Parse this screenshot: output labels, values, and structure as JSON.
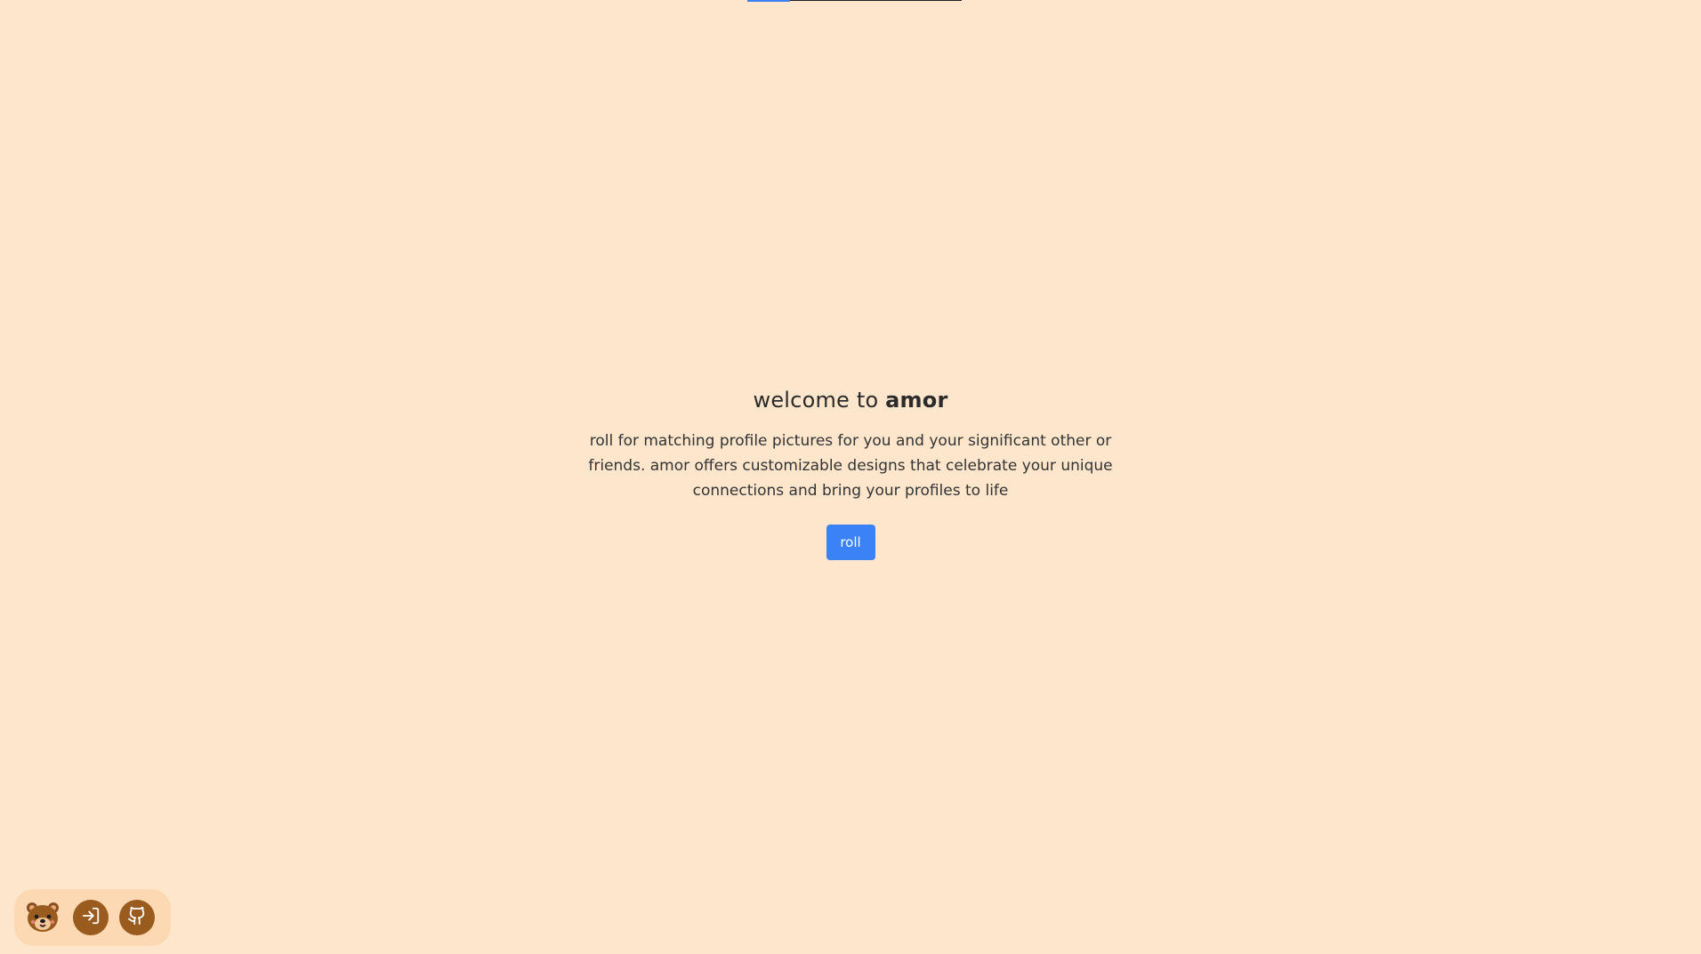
{
  "loading_bar": {
    "progress": 0.2
  },
  "hero": {
    "title_prefix": "welcome to ",
    "title_brand": "amor",
    "description": "roll for matching profile pictures for you and your significant other or friends. amor offers customizable designs that celebrate your unique connections and bring your profiles to life",
    "roll_button_label": "roll"
  },
  "dock": {
    "logo_icon": "bear-icon",
    "items": [
      {
        "icon": "sign-in-icon"
      },
      {
        "icon": "github-icon"
      }
    ]
  },
  "colors": {
    "background": "#fee6cc",
    "accent": "#3b82f6",
    "dock_background": "#fdd9b3",
    "dock_button": "#9a5b1e"
  }
}
